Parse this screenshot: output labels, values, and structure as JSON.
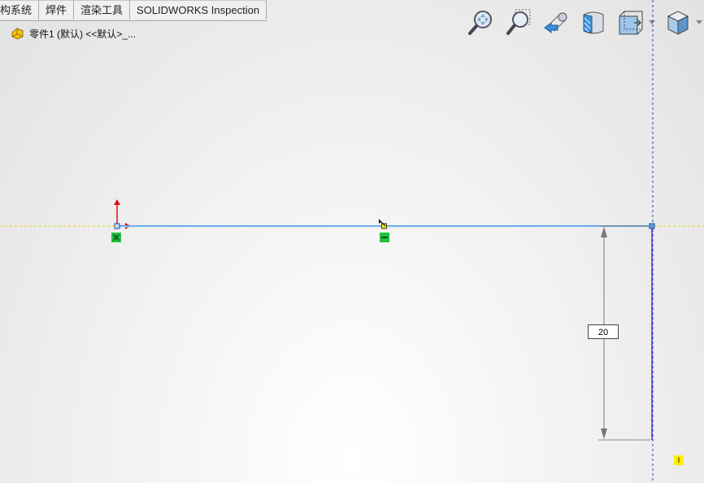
{
  "tabs": [
    "构系统",
    "焊件",
    "渲染工具",
    "SOLIDWORKS Inspection"
  ],
  "breadcrumb": {
    "label": "零件1 (默认) <<默认>_..."
  },
  "toolbar": {
    "icons": [
      "zoom-to-fit-icon",
      "zoom-to-area-icon",
      "previous-view-icon",
      "section-view-icon",
      "view-orientation-icon",
      "display-style-icon"
    ]
  },
  "sketch": {
    "dimension_value": "20",
    "flag_text": "I"
  },
  "colors": {
    "horizontal_inference": "#e8d800",
    "vertical_inference": "#3a3ad0",
    "sketch_line": "#5aa0e0",
    "relation": "#22c040",
    "origin_red": "#e01010"
  }
}
